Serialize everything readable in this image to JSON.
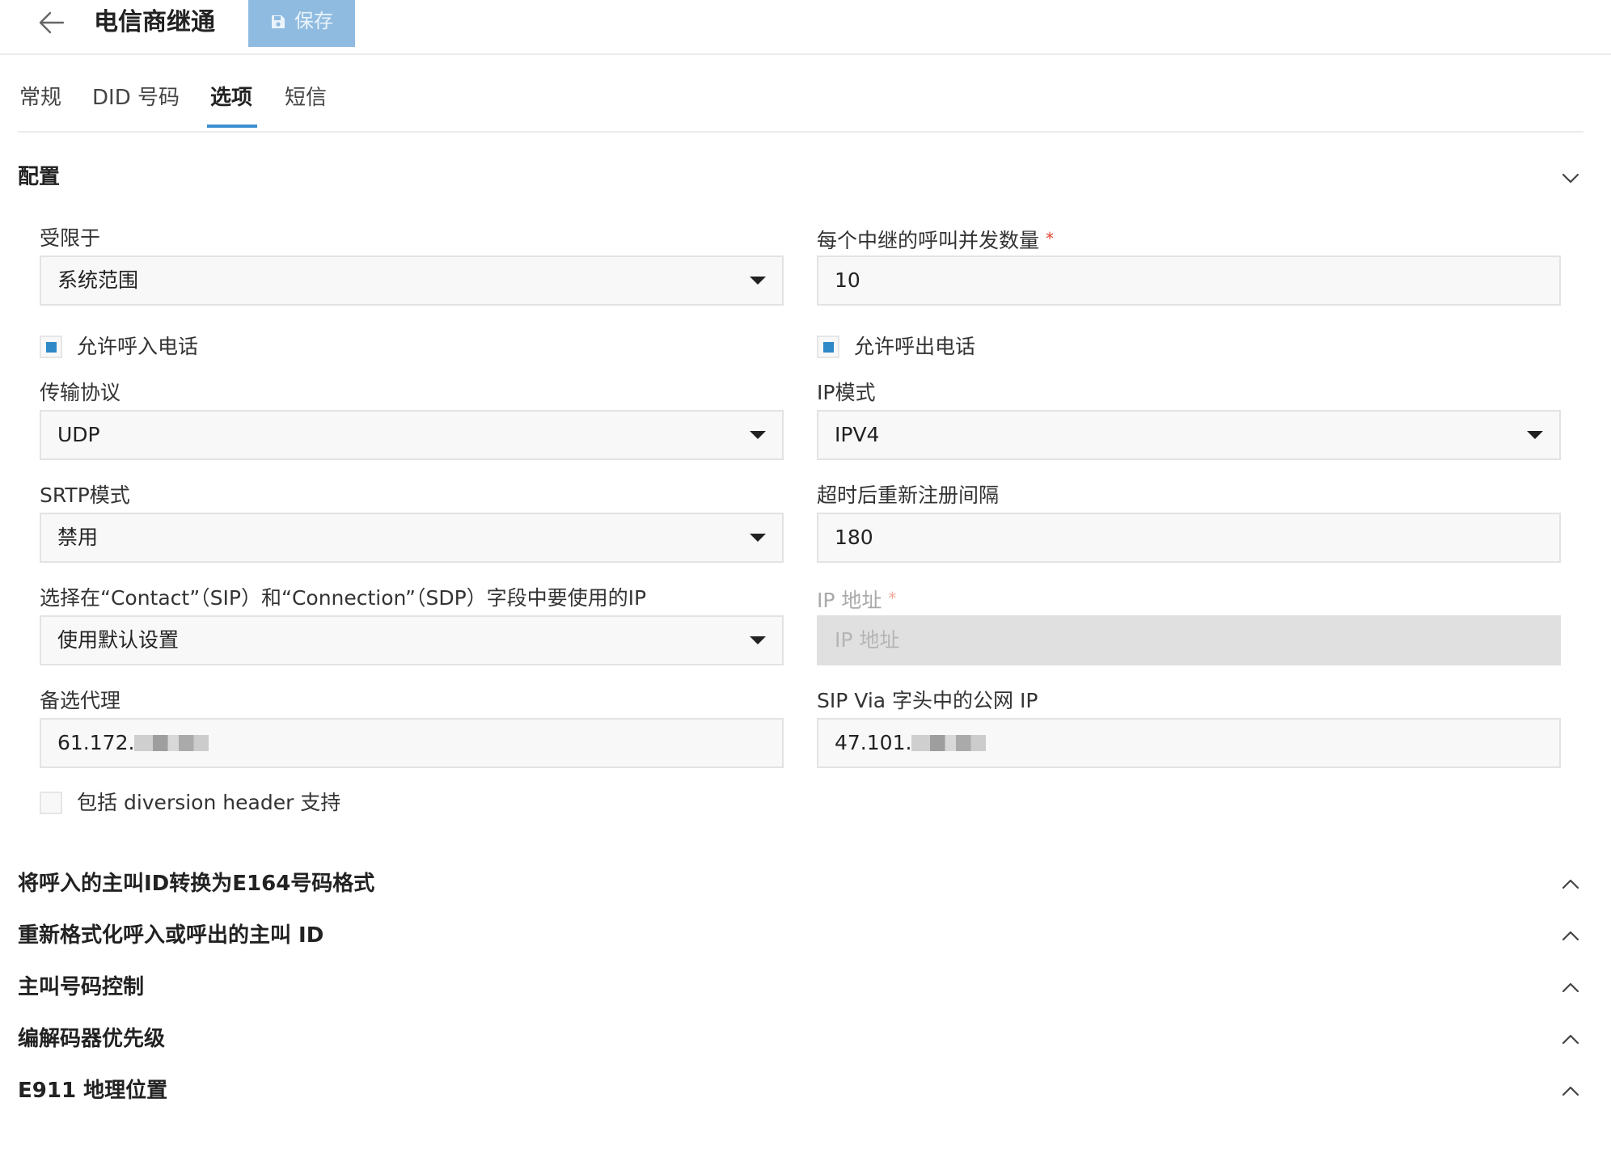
{
  "header": {
    "title": "电信商继通",
    "save_label": "保存"
  },
  "tabs": [
    {
      "label": "常规",
      "active": false
    },
    {
      "label": "DID 号码",
      "active": false
    },
    {
      "label": "选项",
      "active": true
    },
    {
      "label": "短信",
      "active": false
    }
  ],
  "config": {
    "section_title": "配置",
    "restricted_to": {
      "label": "受限于",
      "value": "系统范围"
    },
    "concurrent_calls": {
      "label": "每个中继的呼叫并发数量",
      "required": "*",
      "value": "10"
    },
    "allow_inbound": {
      "label": "允许呼入电话",
      "checked": true
    },
    "allow_outbound": {
      "label": "允许呼出电话",
      "checked": true
    },
    "transport": {
      "label": "传输协议",
      "value": "UDP"
    },
    "ip_mode": {
      "label": "IP模式",
      "value": "IPV4"
    },
    "srtp": {
      "label": "SRTP模式",
      "value": "禁用"
    },
    "reregister_interval": {
      "label": "超时后重新注册间隔",
      "value": "180"
    },
    "contact_ip": {
      "label": "选择在“Contact”（SIP）和“Connection”（SDP）字段中要使用的IP",
      "value": "使用默认设置"
    },
    "ip_address": {
      "label": "IP 地址",
      "required": "*",
      "placeholder": "IP 地址"
    },
    "backup_proxy": {
      "label": "备选代理",
      "value_visible": "61.172."
    },
    "sip_via_ip": {
      "label": "SIP Via 字头中的公网 IP",
      "value_visible": "47.101."
    },
    "diversion": {
      "label": "包括 diversion header 支持",
      "checked": false
    }
  },
  "collapsed_sections": [
    "将呼入的主叫ID转换为E164号码格式",
    "重新格式化呼入或呼出的主叫 ID",
    "主叫号码控制",
    "编解码器优先级",
    "E911 地理位置"
  ],
  "colors": {
    "accent": "#3d8fd1",
    "save_button": "#8fbbe0",
    "required": "#e0452c",
    "checkbox_mark": "#2f88c8"
  }
}
